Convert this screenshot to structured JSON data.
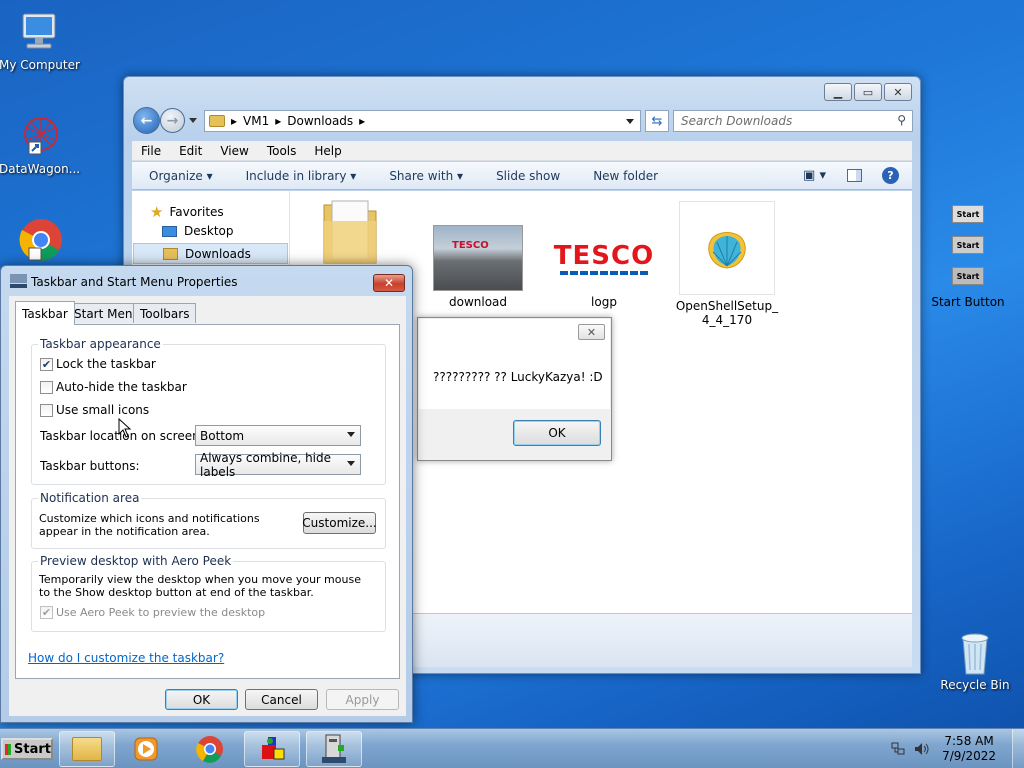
{
  "desktop": {
    "icons": [
      {
        "label": "My Computer"
      },
      {
        "label": "DataWagon..."
      },
      {
        "label": ""
      },
      {
        "label": "Recycle Bin"
      }
    ]
  },
  "explorer": {
    "address": [
      "VM1",
      "Downloads"
    ],
    "search_placeholder": "Search Downloads",
    "menu": [
      "File",
      "Edit",
      "View",
      "Tools",
      "Help"
    ],
    "commands": [
      "Organize",
      "Include in library",
      "Share with",
      "Slide show",
      "New folder"
    ],
    "nav": {
      "favorites": "Favorites",
      "desktop": "Desktop",
      "downloads": "Downloads"
    },
    "files": [
      {
        "name": "download"
      },
      {
        "name": "logp"
      },
      {
        "name": "OpenShellSetup_\n4_4_170"
      },
      {
        "name": "Start Button"
      }
    ]
  },
  "properties": {
    "title": "Taskbar and Start Menu Properties",
    "tabs": [
      "Taskbar",
      "Start Menu",
      "Toolbars"
    ],
    "appearance": {
      "title": "Taskbar appearance",
      "lock": "Lock the taskbar",
      "autohide": "Auto-hide the taskbar",
      "small_icons": "Use small icons",
      "location_label": "Taskbar location on screen:",
      "location_value": "Bottom",
      "buttons_label": "Taskbar buttons:",
      "buttons_value": "Always combine, hide labels"
    },
    "notification": {
      "title": "Notification area",
      "text": "Customize which icons and notifications appear in the notification area.",
      "button": "Customize..."
    },
    "aero": {
      "title": "Preview desktop with Aero Peek",
      "text": "Temporarily view the desktop when you move your mouse to the Show desktop button at end of the taskbar.",
      "checkbox": "Use Aero Peek to preview the desktop"
    },
    "help_link": "How do I customize the taskbar?",
    "buttons": {
      "ok": "OK",
      "cancel": "Cancel",
      "apply": "Apply"
    }
  },
  "msgbox": {
    "text": "????????? ?? LuckyKazya! :D",
    "ok": "OK"
  },
  "taskbar": {
    "start": "Start",
    "time": "7:58 AM",
    "date": "7/9/2022"
  },
  "colors": {
    "accent": "#1e78d8",
    "link": "#0066cc",
    "close": "#c8412c"
  }
}
